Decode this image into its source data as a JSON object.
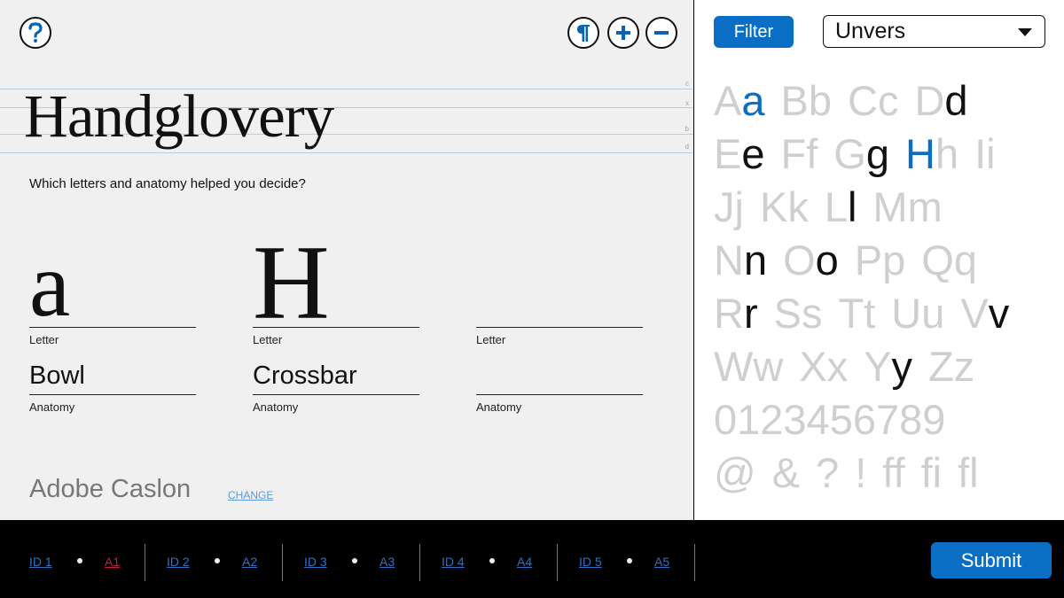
{
  "toolbar": {
    "help_icon": "question-icon",
    "para_icon": "pilcrow-icon",
    "zoom_in_icon": "plus-icon",
    "zoom_out_icon": "minus-icon"
  },
  "guides": [
    "c",
    "x",
    "b",
    "d"
  ],
  "specimen": {
    "word": "Handglovery"
  },
  "question": "Which letters and anatomy helped you decide?",
  "slots": [
    {
      "letter": "a",
      "letter_caption": "Letter",
      "anatomy": "Bowl",
      "anatomy_caption": "Anatomy"
    },
    {
      "letter": "H",
      "letter_caption": "Letter",
      "anatomy": "Crossbar",
      "anatomy_caption": "Anatomy"
    },
    {
      "letter": "",
      "letter_caption": "Letter",
      "anatomy": "",
      "anatomy_caption": "Anatomy"
    }
  ],
  "font": {
    "name": "Adobe Caslon",
    "change_label": "CHANGE"
  },
  "filter": {
    "label": "Filter",
    "selected_font": "Unvers"
  },
  "colors": {
    "accent": "#0a6fc4",
    "active_tab": "#c21f3e",
    "glyph_inactive": "#cfcfcf",
    "glyph_black": "#111111"
  },
  "glyph_rows": [
    [
      {
        "c": "A",
        "s": "grey"
      },
      {
        "c": "a",
        "s": "blue"
      },
      {
        "c": "B",
        "s": "grey"
      },
      {
        "c": "b",
        "s": "grey"
      },
      {
        "c": "C",
        "s": "grey"
      },
      {
        "c": "c",
        "s": "grey"
      },
      {
        "c": "D",
        "s": "grey"
      },
      {
        "c": "d",
        "s": "black"
      }
    ],
    [
      {
        "c": "E",
        "s": "grey"
      },
      {
        "c": "e",
        "s": "black"
      },
      {
        "c": "F",
        "s": "grey"
      },
      {
        "c": "f",
        "s": "grey"
      },
      {
        "c": "G",
        "s": "grey"
      },
      {
        "c": "g",
        "s": "black"
      },
      {
        "c": "H",
        "s": "blue"
      },
      {
        "c": "h",
        "s": "grey"
      },
      {
        "c": "I",
        "s": "grey"
      },
      {
        "c": "i",
        "s": "grey"
      }
    ],
    [
      {
        "c": "J",
        "s": "grey"
      },
      {
        "c": "j",
        "s": "grey"
      },
      {
        "c": "K",
        "s": "grey"
      },
      {
        "c": "k",
        "s": "grey"
      },
      {
        "c": "L",
        "s": "grey"
      },
      {
        "c": "l",
        "s": "black"
      },
      {
        "c": "M",
        "s": "grey"
      },
      {
        "c": "m",
        "s": "grey"
      }
    ],
    [
      {
        "c": "N",
        "s": "grey"
      },
      {
        "c": "n",
        "s": "black"
      },
      {
        "c": "O",
        "s": "grey"
      },
      {
        "c": "o",
        "s": "black"
      },
      {
        "c": "P",
        "s": "grey"
      },
      {
        "c": "p",
        "s": "grey"
      },
      {
        "c": "Q",
        "s": "grey"
      },
      {
        "c": "q",
        "s": "grey"
      }
    ],
    [
      {
        "c": "R",
        "s": "grey"
      },
      {
        "c": "r",
        "s": "black"
      },
      {
        "c": "S",
        "s": "grey"
      },
      {
        "c": "s",
        "s": "grey"
      },
      {
        "c": "T",
        "s": "grey"
      },
      {
        "c": "t",
        "s": "grey"
      },
      {
        "c": "U",
        "s": "grey"
      },
      {
        "c": "u",
        "s": "grey"
      },
      {
        "c": "V",
        "s": "grey"
      },
      {
        "c": "v",
        "s": "black"
      }
    ],
    [
      {
        "c": "W",
        "s": "grey"
      },
      {
        "c": "w",
        "s": "grey"
      },
      {
        "c": "X",
        "s": "grey"
      },
      {
        "c": "x",
        "s": "grey"
      },
      {
        "c": "Y",
        "s": "grey"
      },
      {
        "c": "y",
        "s": "black"
      },
      {
        "c": "Z",
        "s": "grey"
      },
      {
        "c": "z",
        "s": "grey"
      }
    ],
    [
      {
        "c": "0123456789",
        "s": "grey"
      }
    ],
    [
      {
        "c": "@",
        "s": "grey"
      },
      {
        "c": "&",
        "s": "grey"
      },
      {
        "c": "?",
        "s": "grey"
      },
      {
        "c": "!",
        "s": "grey"
      },
      {
        "c": "ff",
        "s": "grey"
      },
      {
        "c": "fi",
        "s": "grey"
      },
      {
        "c": "fl",
        "s": "grey"
      }
    ]
  ],
  "tabs": [
    {
      "id_label": "ID 1",
      "a_label": "A1",
      "active": "a"
    },
    {
      "id_label": "ID 2",
      "a_label": "A2",
      "active": ""
    },
    {
      "id_label": "ID 3",
      "a_label": "A3",
      "active": ""
    },
    {
      "id_label": "ID 4",
      "a_label": "A4",
      "active": ""
    },
    {
      "id_label": "ID 5",
      "a_label": "A5",
      "active": ""
    }
  ],
  "submit_label": "Submit"
}
